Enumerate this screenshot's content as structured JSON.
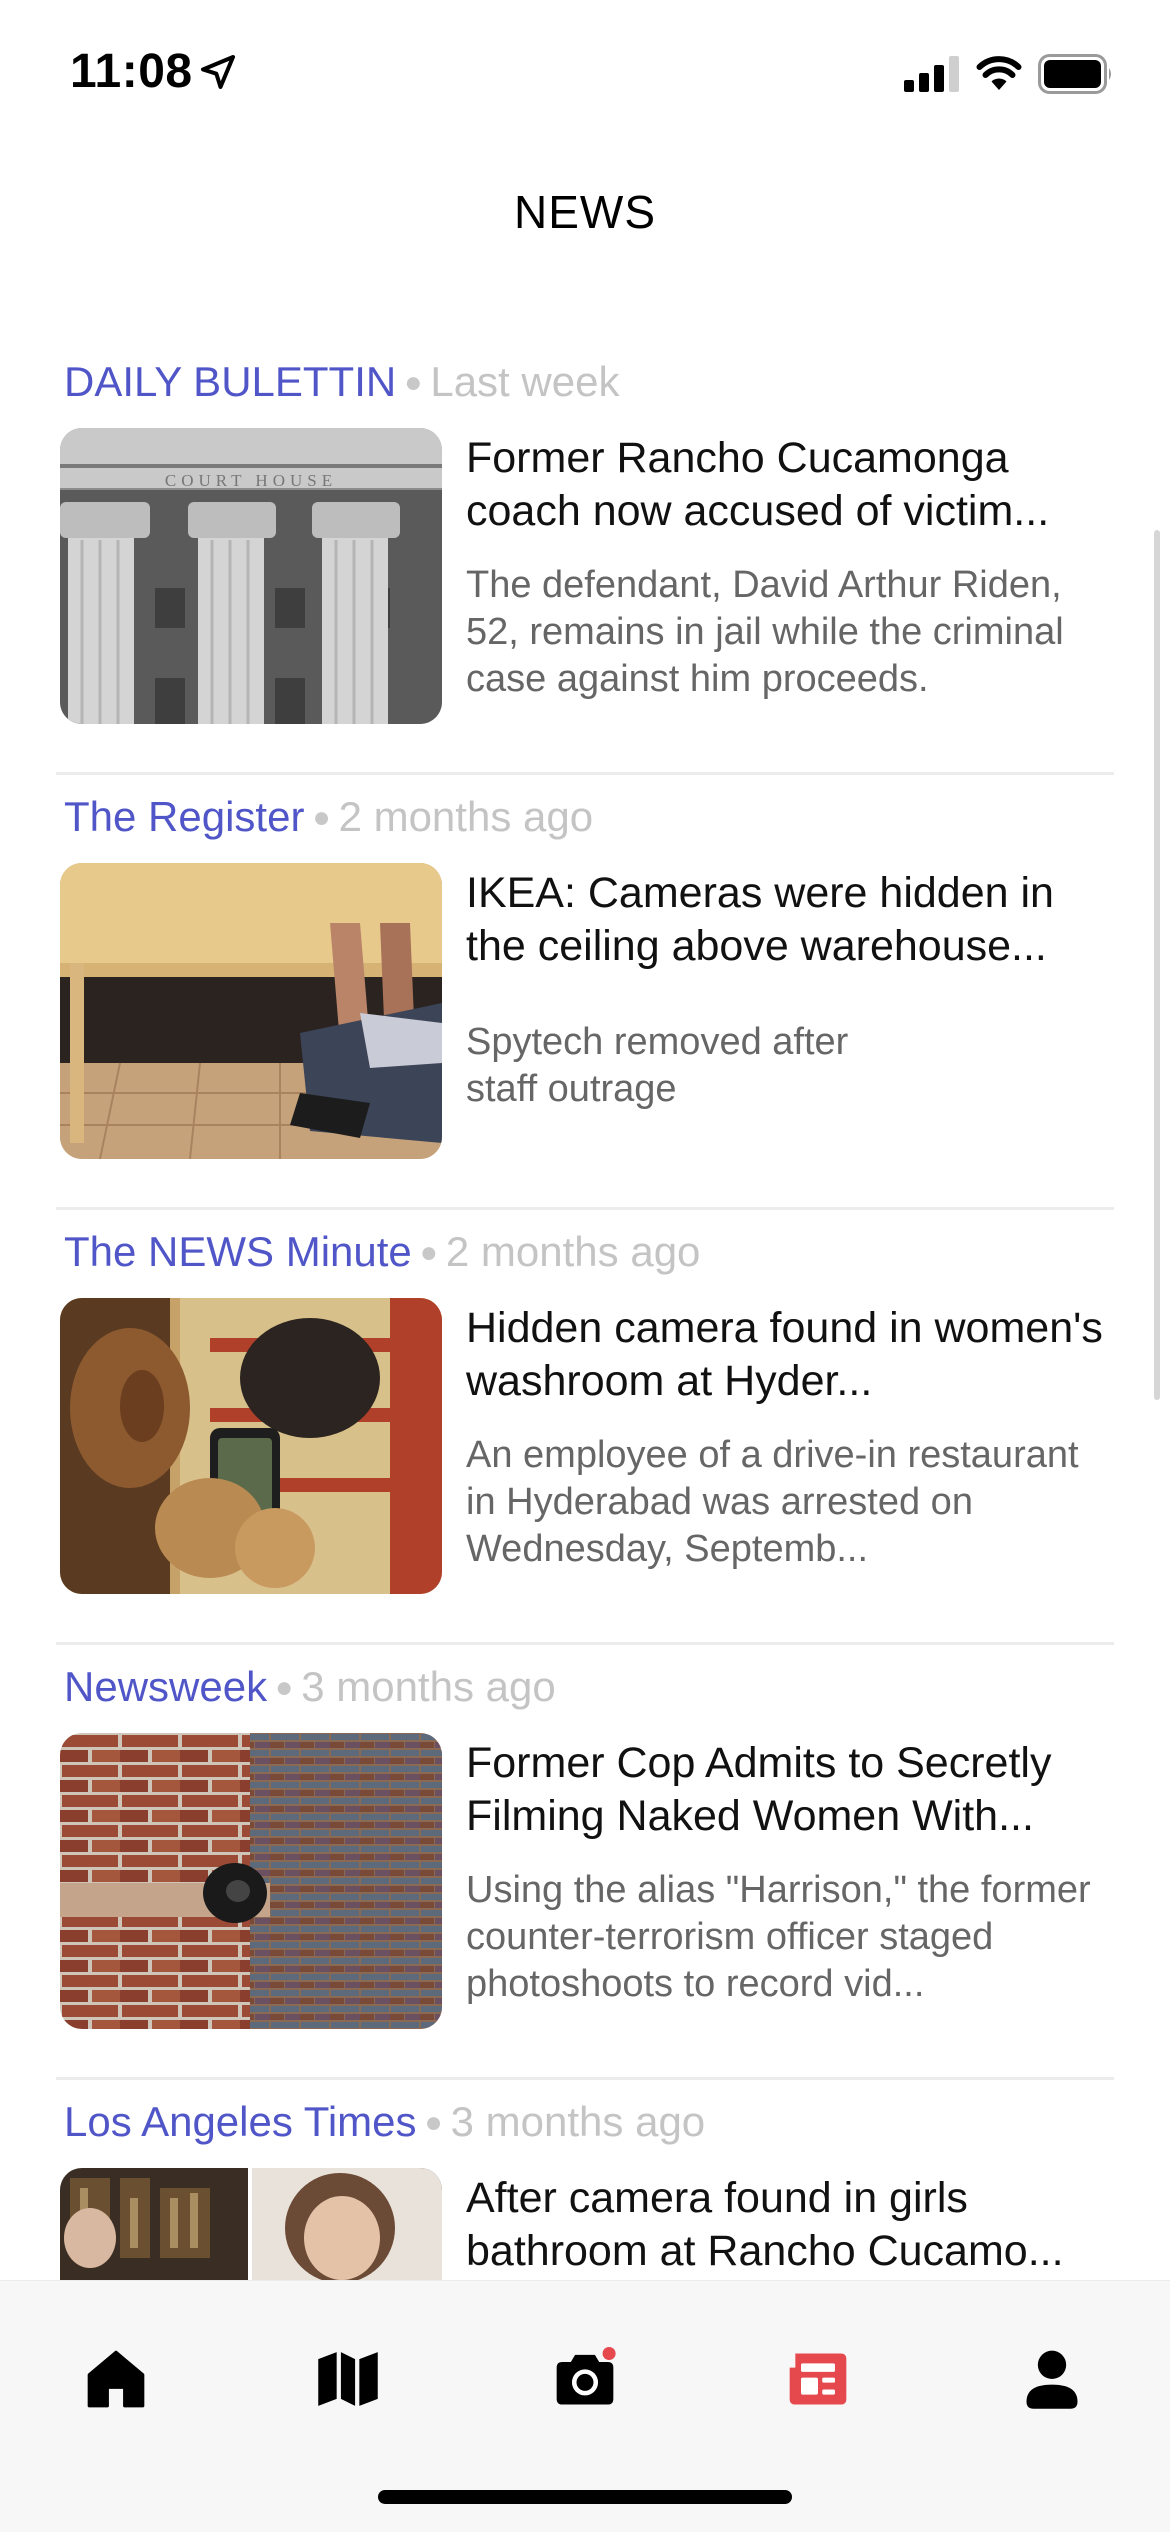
{
  "status_bar": {
    "time": "11:08"
  },
  "page_title": "NEWS",
  "articles": [
    {
      "source": "DAILY BULETTIN",
      "time": "Last week",
      "headline": "Former Rancho Cucamonga coach now accused of victim...",
      "summary": "The defendant, David Arthur Riden, 52, remains in jail while the criminal case against him proceeds.",
      "thumbnail_caption": "COURT HOUSE"
    },
    {
      "source": "The Register",
      "time": "2 months ago",
      "headline": "IKEA: Cameras were hidden in the ceiling above warehouse...",
      "summary": "Spytech removed after staff outrage"
    },
    {
      "source": "The NEWS Minute",
      "time": "2 months ago",
      "headline": "Hidden camera found in women's washroom at Hyder...",
      "summary": "An employee of a drive-in restaurant in Hyderabad was arrested on Wednesday, Septemb..."
    },
    {
      "source": "Newsweek",
      "time": "3 months ago",
      "headline": "Former Cop Admits to Secretly Filming Naked Women With...",
      "summary": "Using the alias \"Harrison,\" the former counter-terrorism officer staged photoshoots to record vid..."
    },
    {
      "source": "Los Angeles Times",
      "time": "3 months ago",
      "headline": "After camera found in girls bathroom at Rancho Cucamo...",
      "summary": ""
    }
  ],
  "tab_bar": {
    "tabs": [
      {
        "name": "home",
        "icon": "home-icon",
        "active": false
      },
      {
        "name": "map",
        "icon": "map-icon",
        "active": false
      },
      {
        "name": "camera",
        "icon": "camera-icon",
        "active": false,
        "badge": true
      },
      {
        "name": "news",
        "icon": "newspaper-icon",
        "active": true
      },
      {
        "name": "profile",
        "icon": "person-icon",
        "active": false
      }
    ]
  },
  "colors": {
    "source": "#5056c8",
    "time": "#c4c4c4",
    "active_tab": "#e5484d",
    "inactive_tab": "#000000",
    "badge": "#e5484d"
  }
}
